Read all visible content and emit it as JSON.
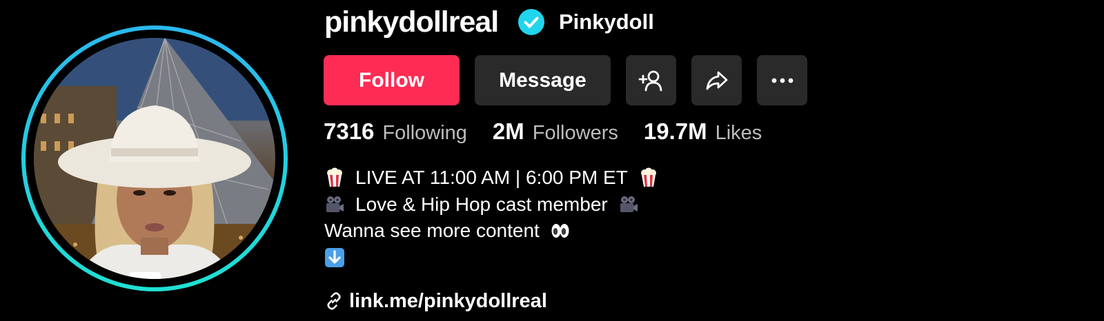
{
  "profile": {
    "username": "pinkydollreal",
    "display_name": "Pinkydoll",
    "verified": true
  },
  "actions": {
    "follow_label": "Follow",
    "message_label": "Message",
    "add_friend_icon": "add-friend-icon",
    "share_icon": "share-icon",
    "more_icon": "more-icon"
  },
  "stats": [
    {
      "value": "7316",
      "label": "Following"
    },
    {
      "value": "2M",
      "label": "Followers"
    },
    {
      "value": "19.7M",
      "label": "Likes"
    }
  ],
  "bio": {
    "line1": "LIVE AT 11:00 AM | 6:00 PM ET",
    "line2": "Love & Hip Hop cast member",
    "line3": "Wanna see more content",
    "emojis": [
      "popcorn-icon",
      "movie-camera-icon",
      "eyes-icon",
      "down-arrow-icon"
    ]
  },
  "link": {
    "text": "link.me/pinkydollreal",
    "icon": "link-icon"
  },
  "colors": {
    "background": "#000000",
    "follow_button": "#fe2c55",
    "secondary_button": "#2a2a2a",
    "verified_badge": "#20d5ec",
    "avatar_ring": "#20d5ec",
    "secondary_text": "#bdbdbd"
  }
}
